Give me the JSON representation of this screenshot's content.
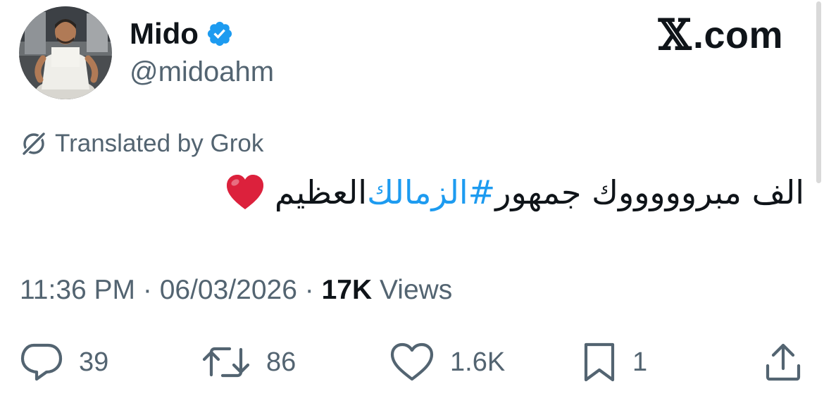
{
  "author": {
    "display_name": "Mido",
    "handle": "@midoahm",
    "verified_icon": "verified-badge-icon",
    "avatar": "profile-photo"
  },
  "brand": {
    "x_glyph": "𝕏",
    "suffix": ".com"
  },
  "translation": {
    "icon": "grok-icon",
    "label": "Translated by Grok"
  },
  "tweet": {
    "text_before": "الف مبروووووك جمهور ",
    "hashtag": "#الزمالك",
    "text_after": " العظيم",
    "emoji": "red-heart"
  },
  "meta": {
    "time": "11:36 PM",
    "sep1": " · ",
    "date": "06/03/2026",
    "sep2": " · ",
    "views_count": "17K",
    "views_label": " Views"
  },
  "actions": {
    "replies": "39",
    "reposts": "86",
    "likes": "1.6K",
    "bookmarks": "1"
  },
  "colors": {
    "accent": "#1d9bf0",
    "text": "#0f1419",
    "muted": "#536471",
    "heart": "#e0245e"
  }
}
